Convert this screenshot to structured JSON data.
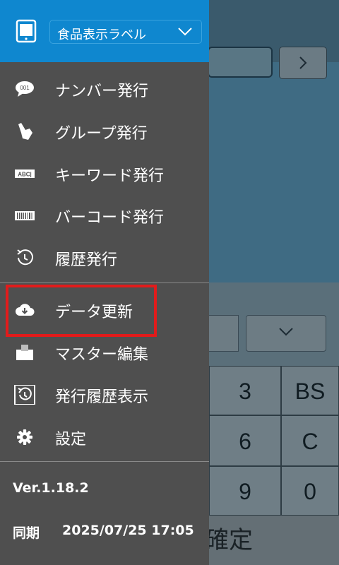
{
  "header": {
    "label_select": "食品表示ラベル",
    "label_select_icon": "tablet-icon"
  },
  "menu": {
    "items": [
      {
        "label": "ナンバー発行",
        "icon": "number-bubble-icon"
      },
      {
        "label": "グループ発行",
        "icon": "pointer-hand-icon"
      },
      {
        "label": "キーワード発行",
        "icon": "keyword-abc-icon"
      },
      {
        "label": "バーコード発行",
        "icon": "barcode-icon"
      },
      {
        "label": "履歴発行",
        "icon": "history-icon"
      },
      {
        "label": "データ更新",
        "icon": "cloud-download-icon"
      },
      {
        "label": "マスター編集",
        "icon": "folder-edit-icon"
      },
      {
        "label": "発行履歴表示",
        "icon": "history-box-icon"
      },
      {
        "label": "設定",
        "icon": "gear-icon"
      }
    ],
    "highlighted": "データ更新"
  },
  "footer": {
    "version": "Ver.1.18.2",
    "sync_label": "同期",
    "sync_value": "2025/07/25 17:05"
  },
  "background": {
    "keys": [
      [
        "3",
        "BS"
      ],
      [
        "6",
        "C"
      ],
      [
        "9",
        "0"
      ]
    ],
    "confirm_label": "確定"
  },
  "colors": {
    "header_blue": "#0f87cf",
    "drawer_bg": "#4f4f4f",
    "highlight_red": "#e21b1b"
  }
}
